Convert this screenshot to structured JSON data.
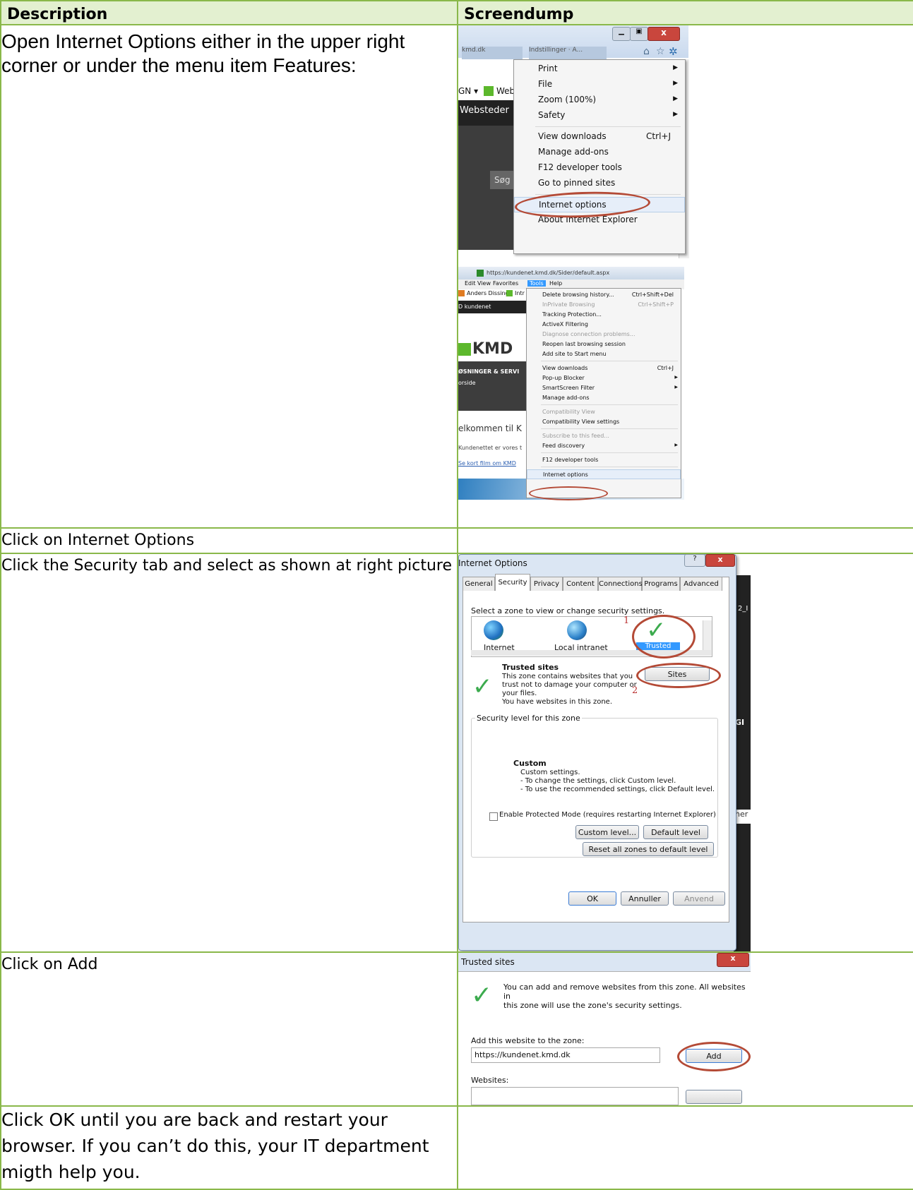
{
  "header": {
    "description": "Description",
    "screendump": "Screendump"
  },
  "rows": {
    "r1": "Open Internet Options either in the upper right corner or under the menu item Features:",
    "r2": "Click on Internet Options",
    "r3": "Click the Security tab and select as shown at right picture",
    "r4": "Click on Add",
    "r5": "Click OK until you are back and restart your browser. If you can’t do this, your IT department migth help you."
  },
  "shot1": {
    "partial_tab_1": "kmd.dk",
    "partial_tab_2": "Indstillinger · A...",
    "fav_left": "GN ▾",
    "fav_web": "Web",
    "nav": "Websteder",
    "search": "Søg",
    "menu": [
      {
        "label": "Print",
        "shortcut": "",
        "sub": true
      },
      {
        "label": "File",
        "shortcut": "",
        "sub": true
      },
      {
        "label": "Zoom (100%)",
        "shortcut": "",
        "sub": true
      },
      {
        "label": "Safety",
        "shortcut": "",
        "sub": true
      },
      {
        "label": "View downloads",
        "shortcut": "Ctrl+J",
        "sub": false
      },
      {
        "label": "Manage add-ons",
        "shortcut": "",
        "sub": false
      },
      {
        "label": "F12 developer tools",
        "shortcut": "",
        "sub": false
      },
      {
        "label": "Go to pinned sites",
        "shortcut": "",
        "sub": false
      },
      {
        "label": "Internet options",
        "shortcut": "",
        "sub": false
      },
      {
        "label": "About Internet Explorer",
        "shortcut": "",
        "sub": false
      }
    ]
  },
  "shot2": {
    "url": "https://kundenet.kmd.dk/Sider/default.aspx",
    "menubar": [
      "Edit",
      "View",
      "Favorites",
      "Tools",
      "Help"
    ],
    "fav1": "Anders Dissing",
    "fav2": "Intr",
    "site": "D kundenet",
    "logo": "KMD",
    "strap": "ØSNINGER & SERVI",
    "forside": "orside",
    "welcome": "elkommen til K",
    "body1": "Kundenettet er vores t",
    "link": "Se kort film om KMD",
    "menu": [
      {
        "label": "Delete browsing history...",
        "shortcut": "Ctrl+Shift+Del",
        "dim": false,
        "sub": false
      },
      {
        "label": "InPrivate Browsing",
        "shortcut": "Ctrl+Shift+P",
        "dim": true,
        "sub": false
      },
      {
        "label": "Tracking Protection...",
        "shortcut": "",
        "dim": false,
        "sub": false
      },
      {
        "label": "ActiveX Filtering",
        "shortcut": "",
        "dim": false,
        "sub": false
      },
      {
        "label": "Diagnose connection problems...",
        "shortcut": "",
        "dim": true,
        "sub": false
      },
      {
        "label": "Reopen last browsing session",
        "shortcut": "",
        "dim": false,
        "sub": false
      },
      {
        "label": "Add site to Start menu",
        "shortcut": "",
        "dim": false,
        "sub": false
      },
      {
        "label": "View downloads",
        "shortcut": "Ctrl+J",
        "dim": false,
        "sub": false
      },
      {
        "label": "Pop-up Blocker",
        "shortcut": "",
        "dim": false,
        "sub": true
      },
      {
        "label": "SmartScreen Filter",
        "shortcut": "",
        "dim": false,
        "sub": true
      },
      {
        "label": "Manage add-ons",
        "shortcut": "",
        "dim": false,
        "sub": false
      },
      {
        "label": "Compatibility View",
        "shortcut": "",
        "dim": true,
        "sub": false
      },
      {
        "label": "Compatibility View settings",
        "shortcut": "",
        "dim": false,
        "sub": false
      },
      {
        "label": "Subscribe to this feed...",
        "shortcut": "",
        "dim": true,
        "sub": false
      },
      {
        "label": "Feed discovery",
        "shortcut": "",
        "dim": false,
        "sub": true
      },
      {
        "label": "F12 developer tools",
        "shortcut": "",
        "dim": false,
        "sub": false
      },
      {
        "label": "Internet options",
        "shortcut": "",
        "dim": false,
        "sub": false
      }
    ]
  },
  "shot3": {
    "title": "Internet Options",
    "tabs": [
      "General",
      "Security",
      "Privacy",
      "Content",
      "Connections",
      "Programs",
      "Advanced"
    ],
    "zone_prompt": "Select a zone to view or change security settings.",
    "zones": [
      "Internet",
      "Local intranet",
      "Trusted sites"
    ],
    "mark1": "1",
    "mark2": "2",
    "zone_title": "Trusted sites",
    "zone_desc": [
      "This zone contains websites that you",
      "trust not to damage your computer or",
      "your files.",
      "You have websites in this zone."
    ],
    "sites_btn": "Sites",
    "level_group": "Security level for this zone",
    "custom_title": "Custom",
    "custom_lines": [
      "Custom settings.",
      "- To change the settings, click Custom level.",
      "- To use the recommended settings, click Default level."
    ],
    "protected": "Enable Protected Mode (requires restarting Internet Explorer)",
    "custom_btn": "Custom level...",
    "default_btn": "Default level",
    "reset_btn": "Reset all zones to default level",
    "ok": "OK",
    "cancel": "Annuller",
    "apply": "Anvend",
    "side1": "2_I",
    "side2": "GI",
    "side3": "ner"
  },
  "shot4": {
    "title": "Trusted sites",
    "info": [
      "You can add and remove websites from this zone. All websites in",
      "this zone will use the zone's security settings."
    ],
    "add_label": "Add this website to the zone:",
    "url": "https://kundenet.kmd.dk",
    "add_btn": "Add",
    "websites": "Websites:"
  }
}
